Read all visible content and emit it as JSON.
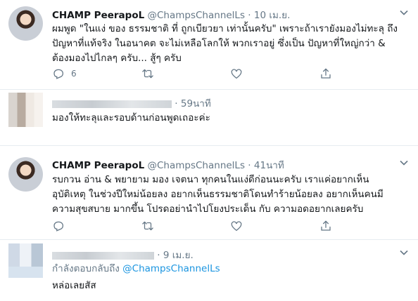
{
  "tweets": [
    {
      "author_name": "CHAMP PeerapoL",
      "handle": "@ChampsChannelLs",
      "separator": "·",
      "time": "10 เม.ย.",
      "lines": [
        "ผมพูด \"ในแง่ ของ ธรรมชาติ ที่ ถูกเบียวยา เท่านั้นครับ\" เพราะถ้าเรายังมองไม่ทะลุ ถึง",
        "ปัญหาที่แท้จริง ในอนาคต จะไม่เหลือโลกให้ พวกเราอยู่ ซึ่งเป็น ปัญหาที่ใหญ่กว่า &",
        "ต้องมองไปไกลๆ ครับ... สู้ๆ ครับ"
      ],
      "reply_count": "6"
    },
    {
      "separator": "·",
      "time": "59นาที",
      "lines": [
        "มองให้ทะลุและรอบด้านก่อนพูดเถอะค่ะ"
      ]
    },
    {
      "author_name": "CHAMP PeerapoL",
      "handle": "@ChampsChannelLs",
      "separator": "·",
      "time": "41นาที",
      "lines": [
        "รบกวน อ่าน & พยายาม มอง เจตนา ทุกคนในแง่ดีก่อนนะครับ เราแค่อยากเห็น",
        "อุบัติเหตุ ในช่วงปีใหม่น้อยลง อยากเห็นธรรมชาติโดนทำร้ายน้อยลง อยากเห็นคนมี",
        "ความสุขสบาย มากขึ้น โปรดอย่านำไปโยงประเด็น กับ ความอดอยากเลยครับ"
      ]
    },
    {
      "separator": "·",
      "time": "9 เม.ย.",
      "replying_label": "กำลังตอบกลับถึง",
      "replying_handle": "@ChampsChannelLs",
      "lines": [
        "หล่อเลยสัส"
      ]
    }
  ],
  "icons": {
    "reply": "reply-icon",
    "retweet": "retweet-icon",
    "like": "heart-icon",
    "share": "share-icon",
    "menu": "chevron-down-icon"
  },
  "colors": {
    "text": "#14171a",
    "secondary": "#657786",
    "link": "#1b95e0",
    "divider": "#e6ecf0"
  }
}
